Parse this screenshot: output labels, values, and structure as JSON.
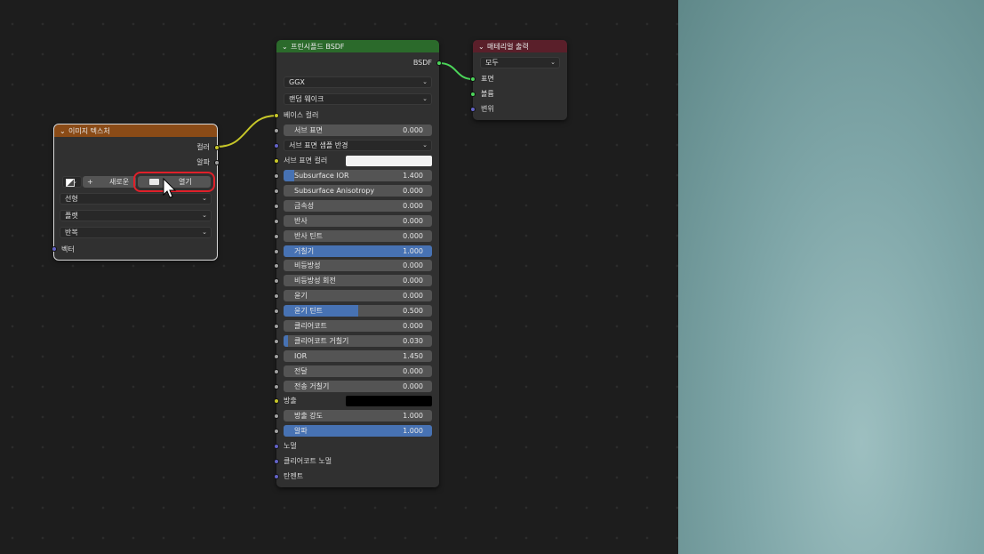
{
  "image_texture": {
    "title": "이미지 텍스처",
    "header_color": "#8a4b17",
    "out_color": "컬러",
    "out_alpha": "알파",
    "new_label": "새로운",
    "new_icon": "+",
    "open_label": "열기",
    "dropdowns": [
      "선형",
      "플랫",
      "반복"
    ],
    "in_vector": "벡터"
  },
  "bsdf": {
    "title": "프린시플드 BSDF",
    "header_color": "#2b6a2b",
    "output": "BSDF",
    "distribution": "GGX",
    "subsurface_method": "랜덤 웨이크",
    "base_color": "베이스 컬러",
    "subsurface_method2": "서브 표면 샘플 반경",
    "subsurface_color": "서브 표면 컬러",
    "fields": [
      {
        "label": "서브 표면",
        "value": "0.000",
        "fill": 0
      },
      {
        "label": "Subsurface IOR",
        "value": "1.400",
        "fill": 0.07
      },
      {
        "label": "Subsurface Anisotropy",
        "value": "0.000",
        "fill": 0
      },
      {
        "label": "금속성",
        "value": "0.000",
        "fill": 0
      },
      {
        "label": "반사",
        "value": "0.000",
        "fill": 0
      },
      {
        "label": "반사 틴트",
        "value": "0.000",
        "fill": 0
      },
      {
        "label": "거칠기",
        "value": "1.000",
        "fill": 1
      },
      {
        "label": "비등방성",
        "value": "0.000",
        "fill": 0
      },
      {
        "label": "비등방성 회전",
        "value": "0.000",
        "fill": 0
      },
      {
        "label": "윤기",
        "value": "0.000",
        "fill": 0
      },
      {
        "label": "윤기 틴트",
        "value": "0.500",
        "fill": 0.5
      },
      {
        "label": "클리어코트",
        "value": "0.000",
        "fill": 0
      },
      {
        "label": "클리어코트 거칠기",
        "value": "0.030",
        "fill": 0.03
      },
      {
        "label": "IOR",
        "value": "1.450",
        "fill": 0
      },
      {
        "label": "전달",
        "value": "0.000",
        "fill": 0
      },
      {
        "label": "전송 거칠기",
        "value": "0.000",
        "fill": 0
      }
    ],
    "emission": "방출",
    "emission_strength": {
      "label": "방출 강도",
      "value": "1.000",
      "fill": 0
    },
    "alpha": {
      "label": "알파",
      "value": "1.000",
      "fill": 1
    },
    "normal": "노멀",
    "clearcoat_normal": "클리어코트 노멀",
    "tangent": "탄젠트"
  },
  "material_output": {
    "title": "매테리얼 출력",
    "header_color": "#5a1f2a",
    "target": "모두",
    "surface": "표면",
    "volume": "볼륨",
    "displacement": "변위"
  },
  "colors": {
    "link_yellow": "#c7c729",
    "link_green": "#4cd65a",
    "highlight_red": "#e0202a",
    "viewport_teal": "#7fa6a8"
  }
}
